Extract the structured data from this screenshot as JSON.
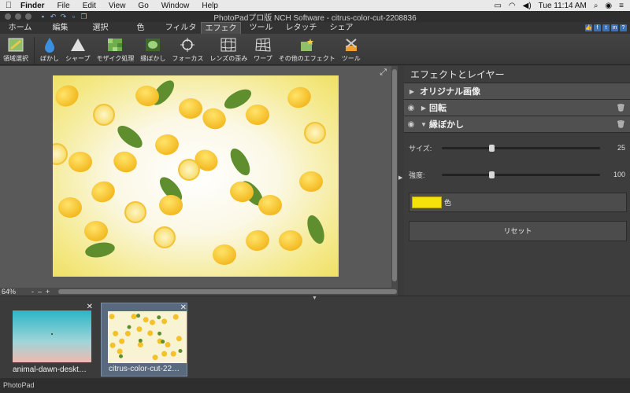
{
  "menubar": {
    "app": "Finder",
    "items": [
      "File",
      "Edit",
      "View",
      "Go",
      "Window",
      "Help"
    ],
    "clock": "Tue 11:14 AM"
  },
  "window": {
    "title": "PhotoPadプロ版 NCH Software - citrus-color-cut-2208836"
  },
  "tabs": [
    {
      "label": "ホーム"
    },
    {
      "label": "編集"
    },
    {
      "label": "選択"
    },
    {
      "label": "色"
    },
    {
      "label": "フィルタ"
    },
    {
      "label": "エフェクト"
    },
    {
      "label": "ツール"
    },
    {
      "label": "レタッチ"
    },
    {
      "label": "シェア"
    }
  ],
  "social": [
    "f",
    "t",
    "in"
  ],
  "toolbar": {
    "items": [
      {
        "label": "領域選択",
        "icon": "region-select-icon"
      },
      {
        "label": "ぼかし",
        "icon": "droplet-icon"
      },
      {
        "label": "シャープ",
        "icon": "triangle-icon"
      },
      {
        "label": "モザイク処理",
        "icon": "mosaic-icon"
      },
      {
        "label": "縁ぼかし",
        "icon": "vignette-icon"
      },
      {
        "label": "フォーカス",
        "icon": "focus-icon"
      },
      {
        "label": "レンズの歪み",
        "icon": "lens-grid-icon"
      },
      {
        "label": "ワープ",
        "icon": "warp-icon"
      },
      {
        "label": "その他のエフェクト",
        "icon": "more-effects-icon"
      },
      {
        "label": "ツール",
        "icon": "tools-icon"
      }
    ]
  },
  "canvas": {
    "zoom": "64%",
    "zoom_controls": [
      "-",
      "–",
      "+"
    ]
  },
  "panel": {
    "title": "エフェクトとレイヤー",
    "layers": [
      {
        "label": "オリジナル画像"
      },
      {
        "label": "回転"
      },
      {
        "label": "縁ぼかし"
      }
    ],
    "size_label": "サイズ:",
    "size_value": "25",
    "size_level": 0.3,
    "strength_label": "強度:",
    "strength_value": "100",
    "strength_level": 0.3,
    "color_label": "色",
    "color_swatch": "#f5e20b",
    "reset_label": "リセット"
  },
  "thumbnails": [
    {
      "label": "animal-dawn-deskt…"
    },
    {
      "label": "citrus-color-cut-22…"
    }
  ],
  "status": "PhotoPad"
}
